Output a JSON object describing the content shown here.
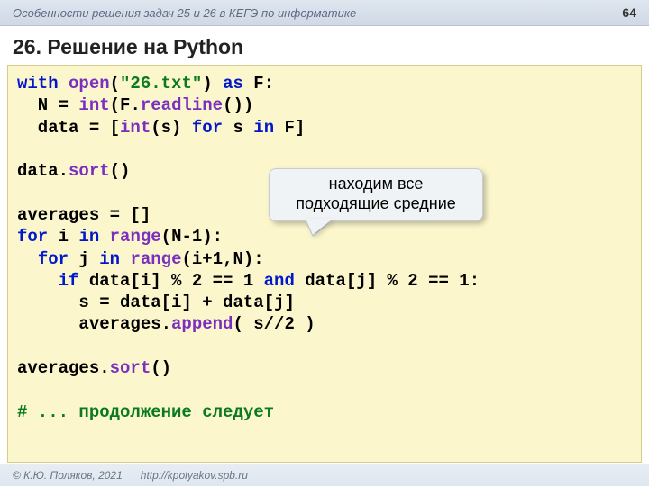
{
  "topbar": {
    "subject": "Особенности решения задач 25 и 26 в КЕГЭ по информатике",
    "page": "64"
  },
  "title": "26. Решение на Python",
  "callout": {
    "line1": "находим все",
    "line2": "подходящие средние"
  },
  "footer": {
    "copyright": "© К.Ю. Поляков, 2021",
    "url": "http://kpolyakov.spb.ru"
  },
  "code": {
    "l1": {
      "with": "with",
      "open": "open",
      "str": "\"26.txt\"",
      "as": "as",
      "rest": " F:"
    },
    "l2": {
      "pre": "  N = ",
      "int": "int",
      "mid": "(F.",
      "readline": "readline",
      "post": "())"
    },
    "l3": {
      "pre": "  data = [",
      "int": "int",
      "mid": "(s) ",
      "for": "for",
      "mid2": " s ",
      "in": "in",
      "post": " F]"
    },
    "l4": {
      "pre": "data.",
      "sort": "sort",
      "post": "()"
    },
    "l5": "averages = []",
    "l6": {
      "for": "for",
      "mid": " i ",
      "in": "in",
      "sp": " ",
      "range": "range",
      "post": "(N-1):"
    },
    "l7": {
      "pre": "  ",
      "for": "for",
      "mid": " j ",
      "in": "in",
      "sp": " ",
      "range": "range",
      "post": "(i+1,N):"
    },
    "l8": {
      "pre": "    ",
      "if": "if",
      "mid": " data[i] % 2 == 1 ",
      "and": "and",
      "post": " data[j] % 2 == 1:"
    },
    "l9": "      s = data[i] + data[j]",
    "l10": {
      "pre": "      averages.",
      "append": "append",
      "post": "( s//2 )"
    },
    "l11": {
      "pre": "averages.",
      "sort": "sort",
      "post": "()"
    },
    "l12": "# ... продолжение следует"
  }
}
